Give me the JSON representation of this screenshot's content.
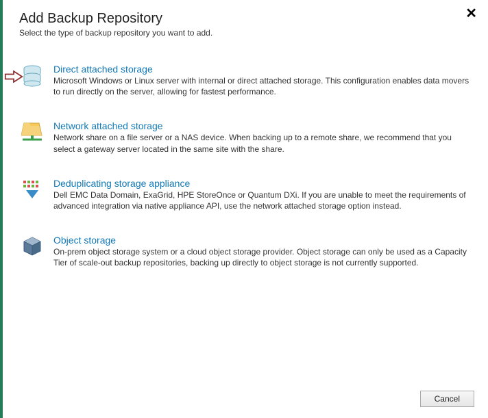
{
  "header": {
    "title": "Add Backup Repository",
    "subtitle": "Select the type of backup repository you want to add."
  },
  "options": [
    {
      "title": "Direct attached storage",
      "description": "Microsoft Windows or Linux server with internal or direct attached storage. This configuration enables data movers to run directly on the server, allowing for fastest performance.",
      "highlighted": true
    },
    {
      "title": "Network attached storage",
      "description": "Network share on a file server or a NAS device. When backing up to a remote share, we recommend that you select a gateway server located in the same site with the share.",
      "highlighted": false
    },
    {
      "title": "Deduplicating storage appliance",
      "description": "Dell EMC Data Domain, ExaGrid, HPE StoreOnce or Quantum DXi. If you are unable to meet the requirements of advanced integration via native appliance API, use the network attached storage option instead.",
      "highlighted": false
    },
    {
      "title": "Object storage",
      "description": "On-prem object storage system or a cloud object storage provider. Object storage can only be used as a Capacity Tier of scale-out backup repositories, backing up directly to object storage is not currently supported.",
      "highlighted": false
    }
  ],
  "footer": {
    "cancel_label": "Cancel"
  }
}
